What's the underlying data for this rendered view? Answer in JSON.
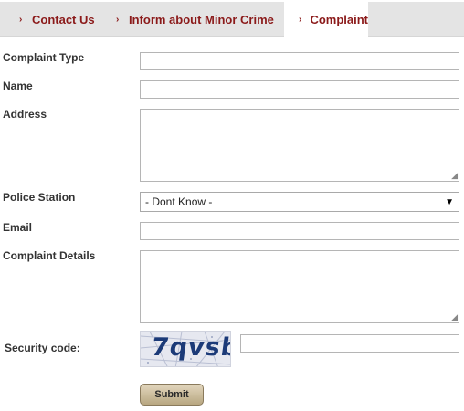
{
  "tabs": [
    {
      "label": "Contact Us",
      "active": false
    },
    {
      "label": "Inform about Minor Crime",
      "active": false
    },
    {
      "label": "Complaint",
      "active": true
    }
  ],
  "tab_bullet": "›",
  "form": {
    "complaint_type": {
      "label": "Complaint Type",
      "value": ""
    },
    "name": {
      "label": "Name",
      "value": ""
    },
    "address": {
      "label": "Address",
      "value": ""
    },
    "police_station": {
      "label": "Police Station",
      "selected": "- Dont Know -"
    },
    "email": {
      "label": "Email",
      "value": ""
    },
    "complaint_details": {
      "label": "Complaint Details",
      "value": ""
    },
    "security_code": {
      "label": "Security code:",
      "captcha_text": "7qvsb",
      "value": ""
    },
    "submit_label": "Submit"
  },
  "colors": {
    "tab_text": "#8b1a1a",
    "tab_bar": "#e4e4e4",
    "captcha_text": "#1b3a78",
    "button": "#c9bb9b"
  }
}
